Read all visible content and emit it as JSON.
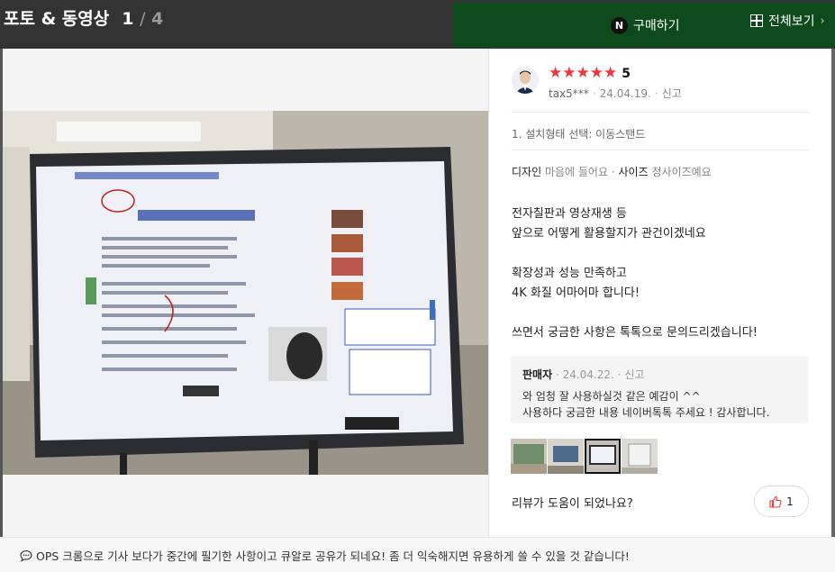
{
  "header": {
    "title": "포토 & 동영상",
    "current": "1",
    "separator": "/",
    "total": "4",
    "buy_label": "구매하기",
    "npay_glyph": "N",
    "view_all_label": "전체보기",
    "accent": "#0d4a1c"
  },
  "review": {
    "rating": "5",
    "stars": [
      "★",
      "★",
      "★",
      "★",
      "★"
    ],
    "star_color": "#f0333c",
    "user": "tax5***",
    "date": "24.04.19.",
    "report": "신고",
    "option": "1. 설치형태 선택: 이동스탠드",
    "attr1_label": "디자인",
    "attr1_value": "마음에 들어요",
    "attr_sep": "·",
    "attr2_label": "사이즈",
    "attr2_value": "정사이즈예요",
    "body_lines": [
      "전자칠판과 영상재생 등",
      "앞으로 어떻게 활용할지가 관건이겠네요",
      "",
      "확장성과 성능 만족하고",
      "4K 화질 어마어마 합니다!",
      "",
      "쓰면서 궁금한 사항은 톡톡으로 문의드리겠습니다!"
    ],
    "seller": {
      "name": "판매자",
      "date": "24.04.22.",
      "report": "신고",
      "reply_lines": [
        "와 엄청 잘 사용하실것 같은 예감이 ^^",
        "사용하다 궁금한 내용 네이버톡톡 주세요 ! 감사합니다."
      ]
    },
    "helpful_question": "리뷰가 도움이 되었나요?",
    "like_count": "1"
  },
  "thumbnails": [
    {
      "selected": false,
      "icon": "classroom-photo"
    },
    {
      "selected": false,
      "icon": "room-photo"
    },
    {
      "selected": true,
      "icon": "board-photo"
    },
    {
      "selected": false,
      "icon": "wall-photo"
    }
  ],
  "footer": {
    "text": "OPS 크롬으로 기사 보다가 중간에 필기한 사항이고 큐알로 공유가 되네요! 좀 더 익숙해지면 유용하게 쓸 수 있을 것 같습니다!"
  }
}
